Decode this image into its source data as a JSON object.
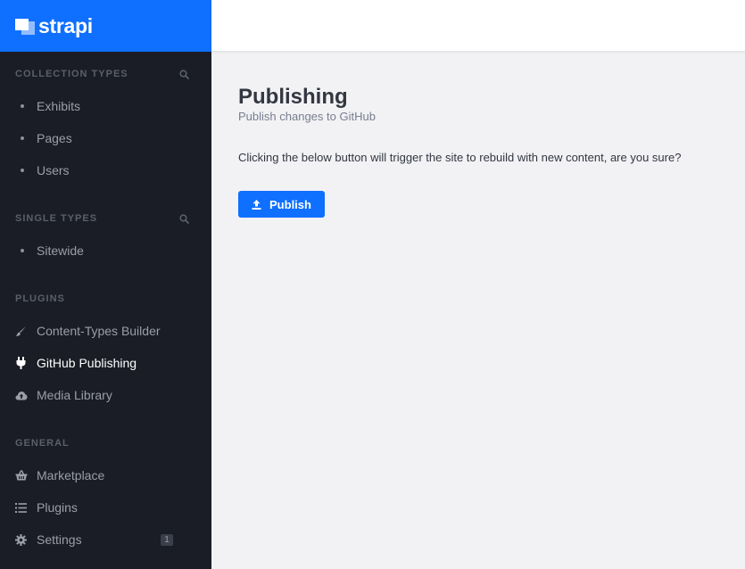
{
  "brand": {
    "name": "strapi"
  },
  "sidebar": {
    "collection_types": {
      "title": "COLLECTION TYPES",
      "items": [
        {
          "label": "Exhibits"
        },
        {
          "label": "Pages"
        },
        {
          "label": "Users"
        }
      ]
    },
    "single_types": {
      "title": "SINGLE TYPES",
      "items": [
        {
          "label": "Sitewide"
        }
      ]
    },
    "plugins": {
      "title": "PLUGINS",
      "items": [
        {
          "label": "Content-Types Builder",
          "icon": "paintbrush-icon"
        },
        {
          "label": "GitHub Publishing",
          "icon": "plug-icon",
          "active": true
        },
        {
          "label": "Media Library",
          "icon": "cloud-upload-icon"
        }
      ]
    },
    "general": {
      "title": "GENERAL",
      "items": [
        {
          "label": "Marketplace",
          "icon": "basket-icon"
        },
        {
          "label": "Plugins",
          "icon": "list-icon"
        },
        {
          "label": "Settings",
          "icon": "gear-icon",
          "badge": "1"
        }
      ]
    }
  },
  "main": {
    "title": "Publishing",
    "subtitle": "Publish changes to GitHub",
    "message": "Clicking the below button will trigger the site to rebuild with new content, are you sure?",
    "publish_label": "Publish"
  },
  "colors": {
    "accent": "#0f6fff",
    "sidebar_bg": "#1a1d25",
    "content_bg": "#f2f2f5"
  }
}
